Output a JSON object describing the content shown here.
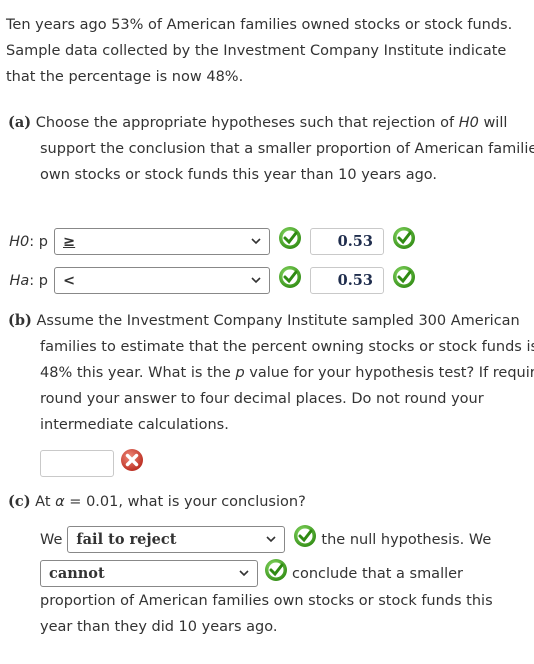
{
  "intro": "Ten years ago 53% of American families owned stocks or stock funds. Sample data collected by the Investment Company Institute indicate that the percentage is now 48%.",
  "part_a": {
    "label": "(a)",
    "text_before": "Choose the appropriate hypotheses such that rejection of ",
    "h0_italic": "H0",
    "text_after": " will support the conclusion that a smaller proportion of American families own stocks or stock funds this year than 10 years ago.",
    "h0": {
      "label_italic": "H0",
      "label_rest": ": p",
      "operator": "≥",
      "value": "0.53",
      "operator_status": "correct",
      "value_status": "correct"
    },
    "ha": {
      "label_italic": "Ha",
      "label_rest": ": p",
      "operator": "<",
      "value": "0.53",
      "operator_status": "correct",
      "value_status": "correct"
    }
  },
  "part_b": {
    "label": "(b)",
    "text_before": "Assume the Investment Company Institute sampled 300 American families to estimate that the percent owning stocks or stock funds is 48% this year. What is the ",
    "p_italic": "p",
    "text_after": " value for your hypothesis test? If required, round your answer to four decimal places. Do not round your intermediate calculations.",
    "answer": "",
    "answer_status": "incorrect"
  },
  "part_c": {
    "label": "(c)",
    "text_before": "At ",
    "alpha_italic": "α",
    "text_after": " = 0.01, what is your conclusion?",
    "we_label": "We",
    "decision": "fail to reject",
    "decision_status": "correct",
    "after_decision": "the null hypothesis. We",
    "can_cannot": "cannot",
    "can_cannot_status": "correct",
    "after_can": "conclude that a smaller",
    "final_text": "proportion of American families own stocks or stock funds this year than they did 10 years ago."
  },
  "colors": {
    "correct": "#3a9a1e",
    "incorrect": "#d23a2f",
    "text": "#333333"
  }
}
